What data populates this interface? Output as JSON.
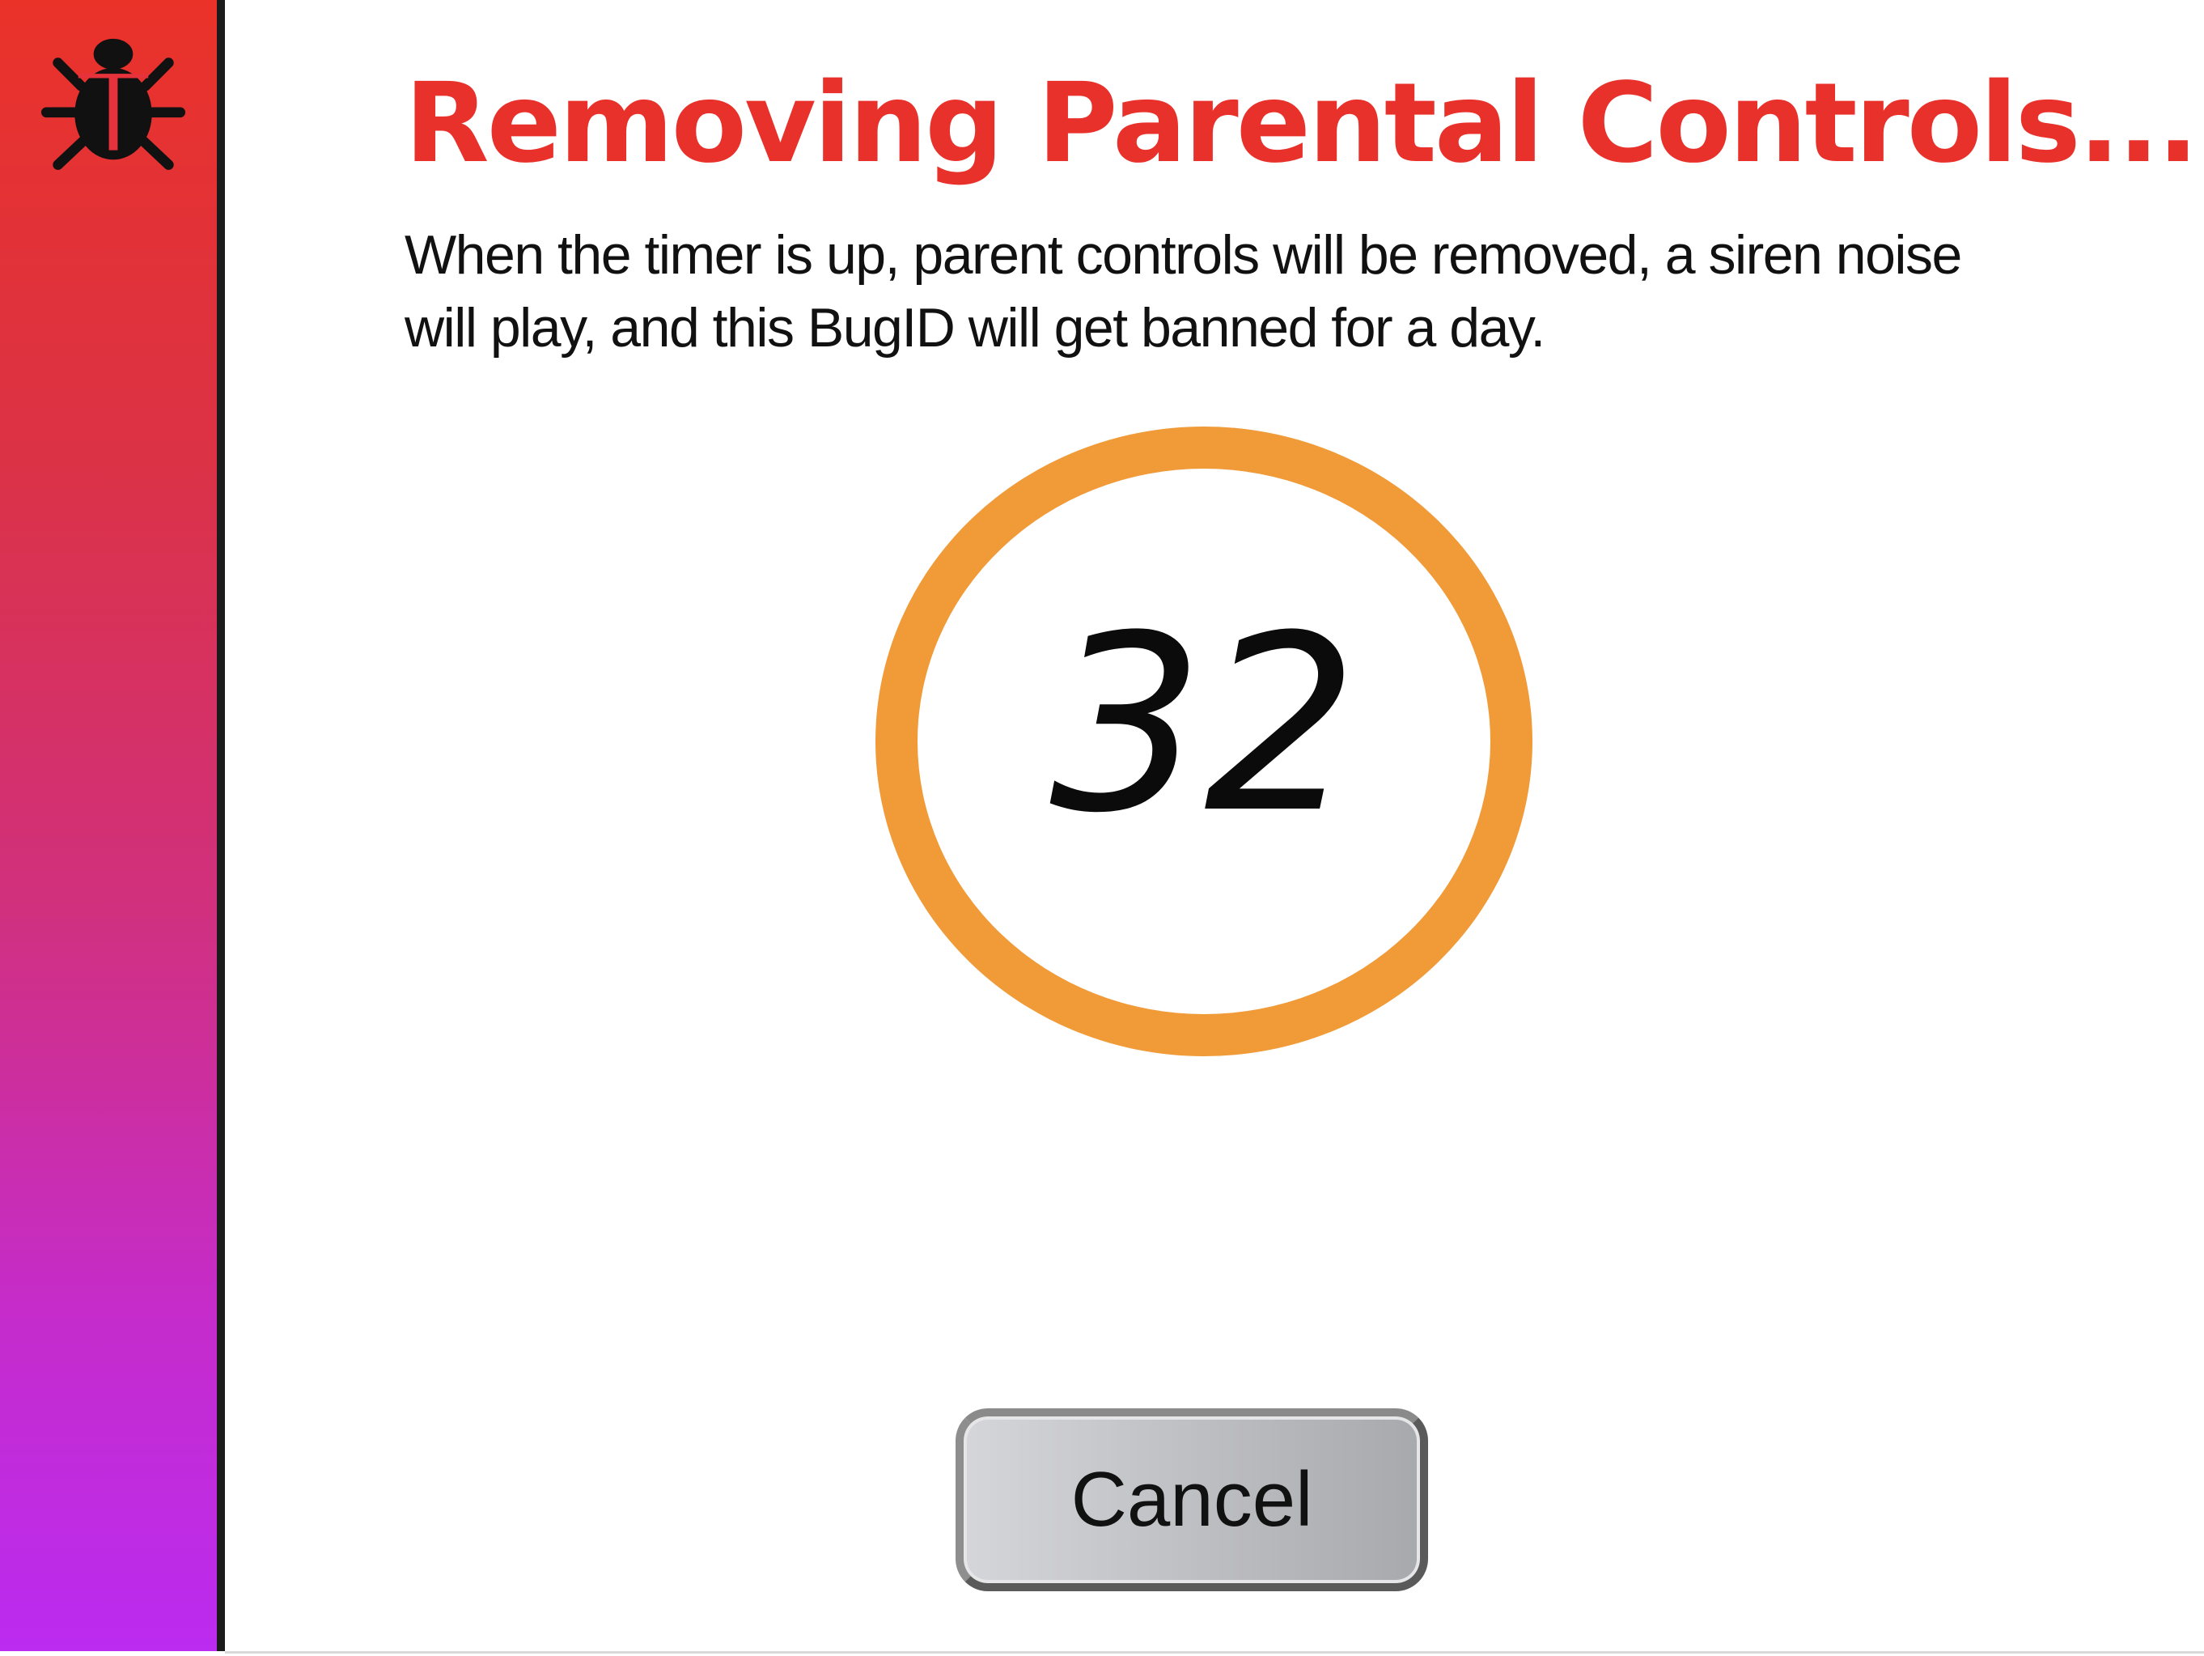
{
  "sidebar": {
    "icon": "bug-icon",
    "gradient_top": "#ea3229",
    "gradient_bottom": "#bb2bf0"
  },
  "header": {
    "title": "Removing Parental Controls...",
    "title_color": "#e9312b"
  },
  "main": {
    "description": "When the timer is up, parent controls will be removed, a siren noise will play, and this BugID will get banned for a day.",
    "timer": {
      "value": "32",
      "ring_color": "#f09a38"
    },
    "cancel_label": "Cancel"
  }
}
